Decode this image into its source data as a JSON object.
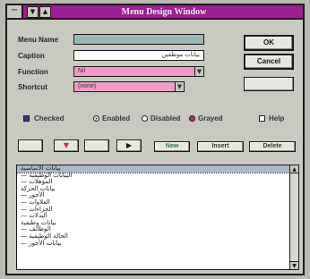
{
  "window": {
    "title": "Menu Design Window"
  },
  "form": {
    "menu_name_label": "Menu Name",
    "menu_name_value": "",
    "caption_label": "Caption",
    "caption_value": "بيانات موظفين",
    "function_label": "Function",
    "function_value": "Nil",
    "shortcut_label": "Shortcut",
    "shortcut_value": "(none)"
  },
  "buttons": {
    "ok": "OK",
    "cancel": "Cancel",
    "help_box": ""
  },
  "options": {
    "checked": "Checked",
    "enabled": "Enabled",
    "disabled": "Disabled",
    "grayed": "Grayed",
    "help": "Help"
  },
  "toolbar": {
    "new": "New",
    "insert": "Insert",
    "delete": "Delete"
  },
  "menu_list": [
    "بيانات الأساسية",
    "— البيانات الوظيفية",
    "— المؤهلات",
    "بيانات الحركة",
    "— الأجور",
    "— العلاوات",
    "— الجزاءات",
    "— البدلات",
    "بيانات وظيفية",
    "— الوظائف",
    "— الحالة الوظيفية",
    "— بيانات الأجور"
  ],
  "colors": {
    "title_bar": "#9c1f92",
    "field_pink": "#ee9cc6",
    "field_teal": "#9ab8b0",
    "selection": "#aab7cc"
  }
}
